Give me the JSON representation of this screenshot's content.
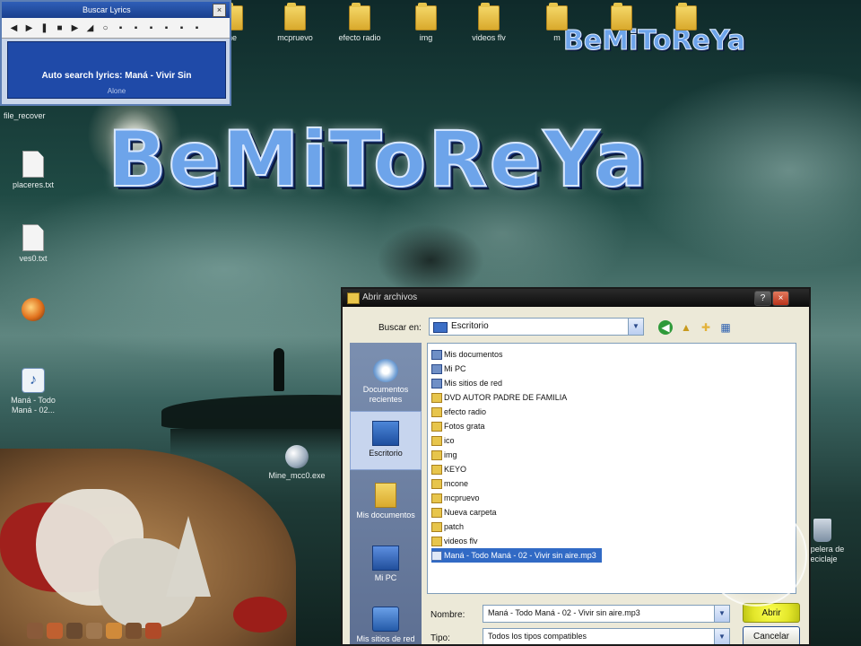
{
  "desktop": {
    "logo_text": "BeMiToReYa",
    "logo_text_small": "BeMiToReYa",
    "top_icons": [
      {
        "label": "ne"
      },
      {
        "label": "mcpruevo"
      },
      {
        "label": "efecto radio"
      },
      {
        "label": "img"
      },
      {
        "label": "videos flv"
      },
      {
        "label": "m"
      }
    ],
    "left_icons": [
      {
        "label": "file_recover",
        "kind": "none"
      },
      {
        "label": "placeres.txt",
        "kind": "doc"
      },
      {
        "label": "ves0.txt",
        "kind": "doc"
      },
      {
        "label": "",
        "kind": "firefox"
      },
      {
        "label": "Maná - Todo Maná - 02...",
        "kind": "media"
      }
    ],
    "center_icon": {
      "label": "Mine_mcc0.exe"
    },
    "right_icon": {
      "label": "Papelera de reciclaje"
    }
  },
  "lyrics_popup": {
    "title": "Buscar Lyrics",
    "message": "Auto search lyrics: Maná - Vivir Sin",
    "status": "Alone"
  },
  "open_dialog": {
    "title": "Abrir archivos",
    "look_in_label": "Buscar en:",
    "look_in_value": "Escritorio",
    "places": [
      {
        "label": "Documentos recientes"
      },
      {
        "label": "Escritorio"
      },
      {
        "label": "Mis documentos"
      },
      {
        "label": "Mi PC"
      },
      {
        "label": "Mis sitios de red"
      }
    ],
    "files": [
      {
        "name": "Mis documentos",
        "kind": "sys"
      },
      {
        "name": "Mi PC",
        "kind": "sys"
      },
      {
        "name": "Mis sitios de red",
        "kind": "sys"
      },
      {
        "name": "DVD AUTOR PADRE DE FAMILIA",
        "kind": "folder"
      },
      {
        "name": "efecto radio",
        "kind": "folder"
      },
      {
        "name": "Fotos grata",
        "kind": "folder"
      },
      {
        "name": "ico",
        "kind": "folder"
      },
      {
        "name": "img",
        "kind": "folder"
      },
      {
        "name": "KEYO",
        "kind": "folder"
      },
      {
        "name": "mcone",
        "kind": "folder"
      },
      {
        "name": "mcpruevo",
        "kind": "folder"
      },
      {
        "name": "Nueva carpeta",
        "kind": "folder"
      },
      {
        "name": "patch",
        "kind": "folder"
      },
      {
        "name": "videos flv",
        "kind": "folder"
      },
      {
        "name": "Maná - Todo Maná - 02 - Vivir sin aire.mp3",
        "kind": "mp3"
      }
    ],
    "name_label": "Nombre:",
    "name_value": "Maná - Todo Maná - 02 - Vivir sin aire.mp3",
    "type_label": "Tipo:",
    "type_value": "Todos los tipos compatibles",
    "open_button": "Abrir",
    "cancel_button": "Cancelar"
  }
}
